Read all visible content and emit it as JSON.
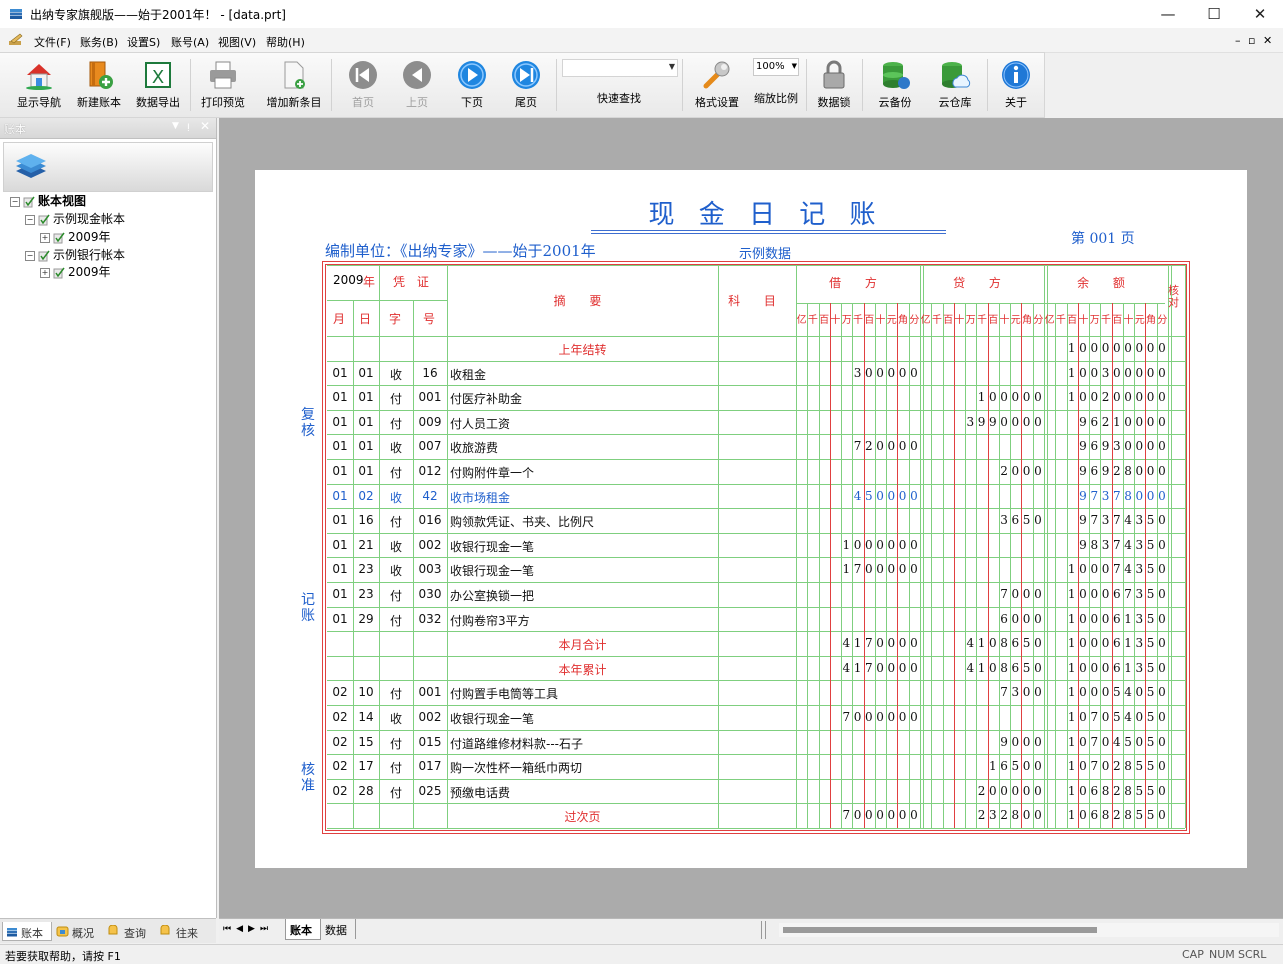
{
  "window": {
    "title": "出纳专家旗舰版——始于2001年！ - [data.prt]",
    "min": "—",
    "max": "☐",
    "close": "✕"
  },
  "menu": [
    "文件(F)",
    "账务(B)",
    "设置S)",
    "账号(A)",
    "视图(V)",
    "帮助(H)"
  ],
  "mdi_controls": "– ▫ ✕",
  "toolbar": {
    "items": [
      {
        "label": "显示导航",
        "icon": "house-icon",
        "enabled": true
      },
      {
        "label": "新建账本",
        "icon": "new-book-icon",
        "enabled": true
      },
      {
        "label": "数据导出",
        "icon": "excel-icon",
        "enabled": true
      },
      {
        "label": "打印预览",
        "icon": "printer-icon",
        "enabled": true
      },
      {
        "label": "增加新条目",
        "icon": "new-document-icon",
        "enabled": true
      },
      {
        "label": "首页",
        "icon": "first-page-icon",
        "enabled": false
      },
      {
        "label": "上页",
        "icon": "prev-page-icon",
        "enabled": false
      },
      {
        "label": "下页",
        "icon": "next-page-icon",
        "enabled": true
      },
      {
        "label": "尾页",
        "icon": "last-page-icon",
        "enabled": true
      },
      {
        "label": "快速查找",
        "icon": "search-combo",
        "enabled": true
      },
      {
        "label": "格式设置",
        "icon": "wrench-icon",
        "enabled": true
      },
      {
        "label": "缩放比例",
        "icon": "zoom-combo",
        "enabled": true
      },
      {
        "label": "数据锁",
        "icon": "lock-icon",
        "enabled": true
      },
      {
        "label": "云备份",
        "icon": "cloud-backup-icon",
        "enabled": true
      },
      {
        "label": "云仓库",
        "icon": "cloud-storage-icon",
        "enabled": true
      },
      {
        "label": "关于",
        "icon": "info-icon",
        "enabled": true
      }
    ],
    "zoom_value": "100%"
  },
  "left_panel": {
    "title": "账本",
    "tree": [
      {
        "label": "账本视图",
        "level": 0,
        "bold": true
      },
      {
        "label": "示例现金帐本",
        "level": 1
      },
      {
        "label": "2009年",
        "level": 2
      },
      {
        "label": "示例银行帐本",
        "level": 1
      },
      {
        "label": "2009年",
        "level": 2
      }
    ],
    "tabs": [
      "账本",
      "概况",
      "查询",
      "往来"
    ]
  },
  "sheet_tabs": [
    "账本",
    "数据"
  ],
  "status": {
    "help": "若要获取帮助，请按 F1",
    "caps": "CAP",
    "num": "NUM",
    "scrl": "SCRL"
  },
  "ledger": {
    "title": "现 金 日 记 账",
    "page_label": "第 001 页",
    "unit": "编制单位：《出纳专家》——始于2001年",
    "sample": "示例数据",
    "side_labels": [
      "复核",
      "记账",
      "核准"
    ],
    "header": {
      "year": "2009",
      "year_unit": "年",
      "voucher": "凭 证",
      "month": "月",
      "day": "日",
      "char": "字",
      "num": "号",
      "summary": "摘 要",
      "subject": "科 目",
      "debit": "借 方",
      "credit": "贷 方",
      "balance": "余 额",
      "check": "核对",
      "digits": [
        "亿",
        "千",
        "百",
        "十",
        "万",
        "千",
        "百",
        "十",
        "元",
        "角",
        "分"
      ]
    },
    "rows": [
      {
        "m": "",
        "d": "",
        "z": "",
        "n": "",
        "summary": "上年结转",
        "debit": "",
        "credit": "",
        "balance": "100000000",
        "kind": "total"
      },
      {
        "m": "01",
        "d": "01",
        "z": "收",
        "n": "16",
        "summary": "收租金",
        "debit": "300000",
        "credit": "",
        "balance": "100300000",
        "kind": "normal"
      },
      {
        "m": "01",
        "d": "01",
        "z": "付",
        "n": "001",
        "summary": "付医疗补助金",
        "debit": "",
        "credit": "100000",
        "balance": "100200000",
        "kind": "normal"
      },
      {
        "m": "01",
        "d": "01",
        "z": "付",
        "n": "009",
        "summary": "付人员工资",
        "debit": "",
        "credit": "3990000",
        "balance": "96210000",
        "kind": "normal"
      },
      {
        "m": "01",
        "d": "01",
        "z": "收",
        "n": "007",
        "summary": "收旅游费",
        "debit": "720000",
        "credit": "",
        "balance": "96930000",
        "kind": "normal"
      },
      {
        "m": "01",
        "d": "01",
        "z": "付",
        "n": "012",
        "summary": "付购附件章一个",
        "debit": "",
        "credit": "2000",
        "balance": "96928000",
        "kind": "normal"
      },
      {
        "m": "01",
        "d": "02",
        "z": "收",
        "n": "42",
        "summary": "收市场租金",
        "debit": "450000",
        "credit": "",
        "balance": "97378000",
        "kind": "highlight"
      },
      {
        "m": "01",
        "d": "16",
        "z": "付",
        "n": "016",
        "summary": "购领款凭证、书夹、比例尺",
        "debit": "",
        "credit": "3650",
        "balance": "97374350",
        "kind": "normal"
      },
      {
        "m": "01",
        "d": "21",
        "z": "收",
        "n": "002",
        "summary": "收银行现金一笔",
        "debit": "1000000",
        "credit": "",
        "balance": "98374350",
        "kind": "normal"
      },
      {
        "m": "01",
        "d": "23",
        "z": "收",
        "n": "003",
        "summary": "收银行现金一笔",
        "debit": "1700000",
        "credit": "",
        "balance": "100074350",
        "kind": "normal"
      },
      {
        "m": "01",
        "d": "23",
        "z": "付",
        "n": "030",
        "summary": "办公室换锁一把",
        "debit": "",
        "credit": "7000",
        "balance": "100067350",
        "kind": "normal"
      },
      {
        "m": "01",
        "d": "29",
        "z": "付",
        "n": "032",
        "summary": "付购卷帘3平方",
        "debit": "",
        "credit": "6000",
        "balance": "100061350",
        "kind": "normal"
      },
      {
        "m": "",
        "d": "",
        "z": "",
        "n": "",
        "summary": "本月合计",
        "debit": "4170000",
        "credit": "4108650",
        "balance": "100061350",
        "kind": "total"
      },
      {
        "m": "",
        "d": "",
        "z": "",
        "n": "",
        "summary": "本年累计",
        "debit": "4170000",
        "credit": "4108650",
        "balance": "100061350",
        "kind": "total"
      },
      {
        "m": "02",
        "d": "10",
        "z": "付",
        "n": "001",
        "summary": "付购置手电筒等工具",
        "debit": "",
        "credit": "7300",
        "balance": "100054050",
        "kind": "normal"
      },
      {
        "m": "02",
        "d": "14",
        "z": "收",
        "n": "002",
        "summary": "收银行现金一笔",
        "debit": "7000000",
        "credit": "",
        "balance": "107054050",
        "kind": "normal"
      },
      {
        "m": "02",
        "d": "15",
        "z": "付",
        "n": "015",
        "summary": "付道路维修材料款---石子",
        "debit": "",
        "credit": "9000",
        "balance": "107045050",
        "kind": "normal"
      },
      {
        "m": "02",
        "d": "17",
        "z": "付",
        "n": "017",
        "summary": "购一次性杯一箱纸巾两切",
        "debit": "",
        "credit": "16500",
        "balance": "107028550",
        "kind": "normal"
      },
      {
        "m": "02",
        "d": "28",
        "z": "付",
        "n": "025",
        "summary": "预缴电话费",
        "debit": "",
        "credit": "200000",
        "balance": "106828550",
        "kind": "normal"
      },
      {
        "m": "",
        "d": "",
        "z": "",
        "n": "",
        "summary": "过次页",
        "debit": "7000000",
        "credit": "232800",
        "balance": "106828550",
        "kind": "total"
      }
    ]
  }
}
